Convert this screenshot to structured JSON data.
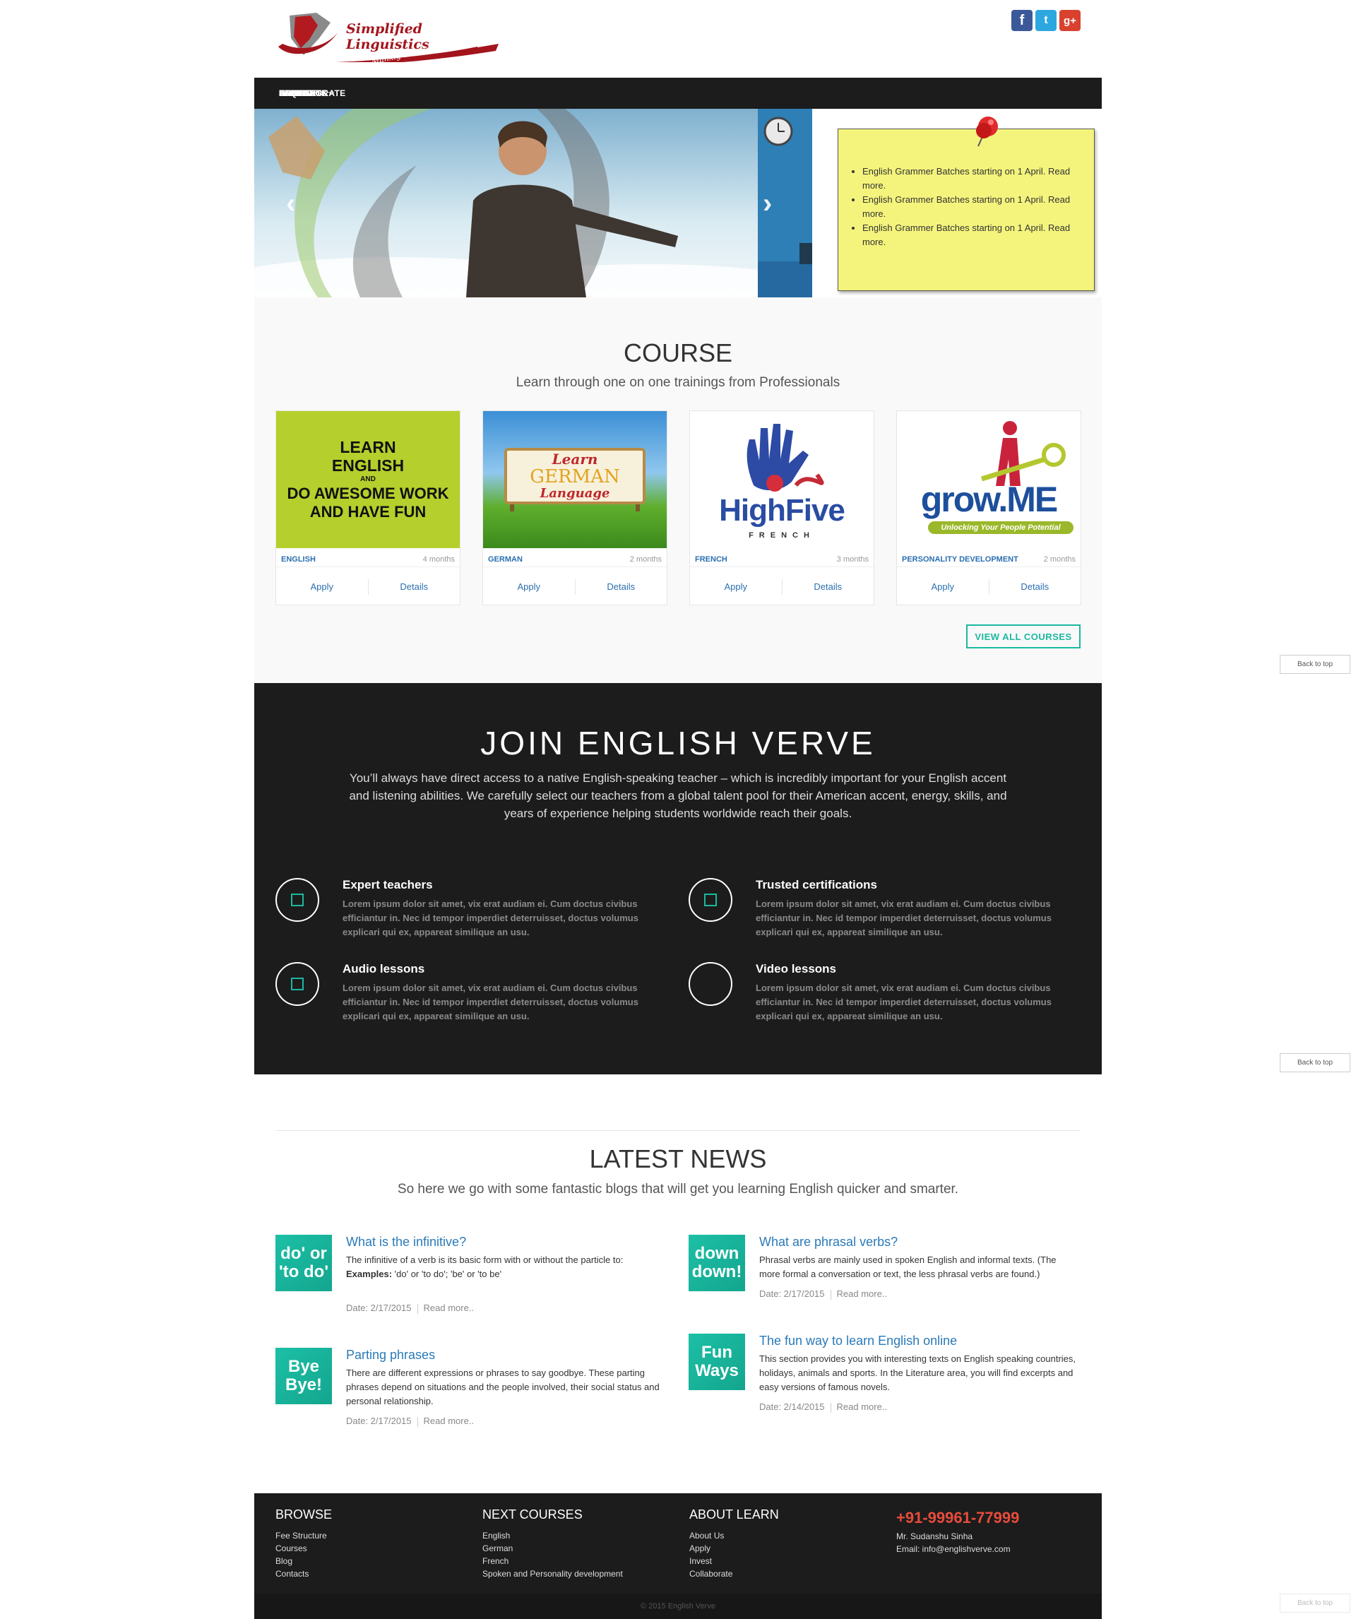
{
  "brand": {
    "title": "Simplified Linguistics",
    "tagline": "Mankig You Global",
    "social": [
      {
        "icon": "facebook-icon",
        "glyph": "f",
        "color": "#3b5998"
      },
      {
        "icon": "twitter-icon",
        "glyph": "t",
        "color": "#2da7e0"
      },
      {
        "icon": "google-plus-icon",
        "glyph": "g+",
        "color": "#d9412f"
      }
    ]
  },
  "nav": {
    "items": [
      "HOME",
      "ABOUT",
      "COURSES",
      "SUPPORT",
      "FEEDBACK",
      "FAQ",
      "BLOG",
      "INVEST",
      "COLLABORATE",
      "CONTACTS"
    ]
  },
  "slider": {
    "prev": "‹",
    "next": "›"
  },
  "notice": {
    "items": [
      "English Grammer Batches starting on 1 April. Read more.",
      "English Grammer Batches starting on 1 April. Read more.",
      "English Grammer Batches starting on 1 April. Read more."
    ]
  },
  "course": {
    "title": "COURSE",
    "subtitle": "Learn through one on one trainings from Professionals",
    "cards": [
      {
        "name": "ENGLISH",
        "duration": "4 months",
        "apply": "Apply",
        "details": "Details",
        "img_lines": [
          "LEARN",
          "ENGLISH",
          "AND",
          "DO AWESOME WORK",
          "AND HAVE FUN"
        ]
      },
      {
        "name": "GERMAN",
        "duration": "2 months",
        "apply": "Apply",
        "details": "Details",
        "img_lines": [
          "Learn",
          "GERMAN",
          "Language"
        ]
      },
      {
        "name": "FRENCH",
        "duration": "3 months",
        "apply": "Apply",
        "details": "Details",
        "img_lines": [
          "HighFive",
          "FRENCH"
        ]
      },
      {
        "name": "PERSONALITY DEVELOPMENT",
        "duration": "2 months",
        "apply": "Apply",
        "details": "Details",
        "img_lines": [
          "grow.ME",
          "Unlocking Your People Potential"
        ]
      }
    ],
    "view_all": "VIEW ALL COURSES"
  },
  "back_to_top": "Back to top",
  "join": {
    "title": "JOIN ENGLISH VERVE",
    "text": "You’ll always have direct access to a native English-speaking teacher – which is incredibly important for your English accent and listening abilities. We carefully select our teachers from a global talent pool for their American accent, energy, skills, and years of experience helping students worldwide reach their goals.",
    "features": [
      {
        "title": "Expert teachers",
        "text": "Lorem ipsum dolor sit amet, vix erat audiam ei. Cum doctus civibus efficiantur in. Nec id tempor imperdiet deterruisset, doctus volumus explicari qui ex, appareat similique an usu."
      },
      {
        "title": "Trusted certifications",
        "text": "Lorem ipsum dolor sit amet, vix erat audiam ei. Cum doctus civibus efficiantur in. Nec id tempor imperdiet deterruisset, doctus volumus explicari qui ex, appareat similique an usu."
      },
      {
        "title": "Audio lessons",
        "text": "Lorem ipsum dolor sit amet, vix erat audiam ei. Cum doctus civibus efficiantur in. Nec id tempor imperdiet deterruisset, doctus volumus explicari qui ex, appareat similique an usu."
      },
      {
        "title": "Video lessons",
        "text": "Lorem ipsum dolor sit amet, vix erat audiam ei. Cum doctus civibus efficiantur in. Nec id tempor imperdiet deterruisset, doctus volumus explicari qui ex, appareat similique an usu."
      }
    ]
  },
  "news": {
    "title": "LATEST NEWS",
    "subtitle": "So here we go with some fantastic blogs that will get you learning English quicker and smarter.",
    "items": [
      {
        "thumb": "do' or 'to do'",
        "title": "What is the infinitive?",
        "text_prefix": "The infinitive of a verb is its basic form with or without the particle to: ",
        "text_bold": "Examples:",
        "text_rest": " 'do' or 'to do'; 'be' or 'to be'",
        "date": "Date: 2/17/2015",
        "more": "Read more.."
      },
      {
        "thumb": "down down!",
        "title": "What are phrasal verbs?",
        "text": "Phrasal verbs are mainly used in spoken English and informal texts. (The more formal a conversation or text, the less phrasal verbs are found.)",
        "date": "Date: 2/17/2015",
        "more": "Read more.."
      },
      {
        "thumb": "Bye Bye!",
        "title": "Parting phrases",
        "text": "There are different expressions or phrases to say goodbye. These parting phrases depend on situations and the people involved, their social status and personal relationship.",
        "date": "Date: 2/17/2015",
        "more": "Read more.."
      },
      {
        "thumb": "Fun Ways",
        "title": "The fun way to learn English online",
        "text": "This section provides you with interesting texts on English speaking countries, holidays, animals and sports. In the Literature area, you will find excerpts and easy versions of famous novels.",
        "date": "Date: 2/14/2015",
        "more": "Read more.."
      }
    ]
  },
  "footer": {
    "browse": {
      "title": "BROWSE",
      "links": [
        "Fee Structure",
        "Courses",
        "Blog",
        "Contacts"
      ]
    },
    "next_courses": {
      "title": "NEXT COURSES",
      "links": [
        "English",
        "German",
        "French",
        "Spoken and Personality development"
      ]
    },
    "about": {
      "title": "ABOUT LEARN",
      "links": [
        "About Us",
        "Apply",
        "Invest",
        "Collaborate"
      ]
    },
    "contact": {
      "phone": "+91-99961-77999",
      "name": "Mr. Sudanshu Sinha",
      "email": "Email: info@englishverve.com"
    },
    "copyright": "© 2015 English Verve"
  }
}
